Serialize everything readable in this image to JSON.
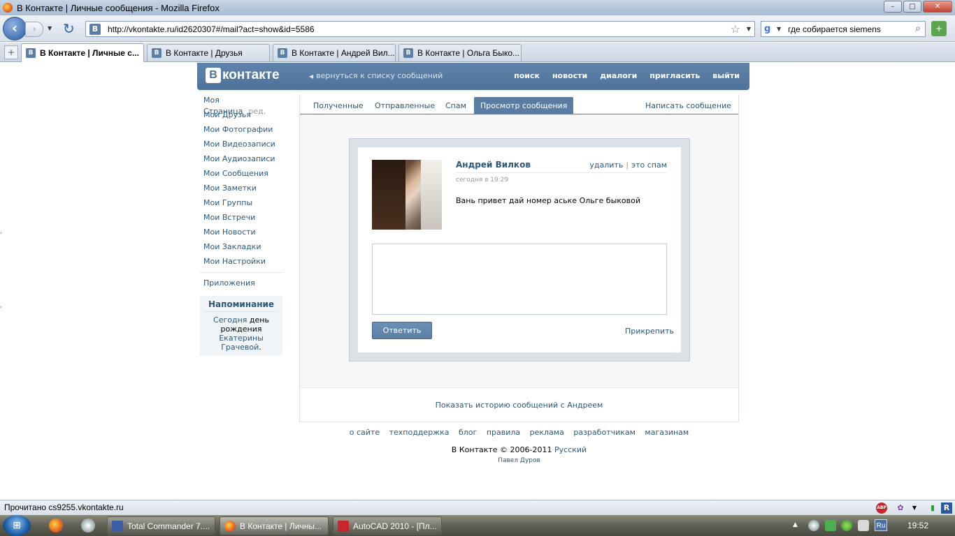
{
  "window": {
    "title": "В Контакте | Личные сообщения - Mozilla Firefox",
    "buttons": {
      "minimize": "–",
      "maximize": "□",
      "close": "✕"
    }
  },
  "navbar": {
    "url": "http://vkontakte.ru/id2620307#/mail?act=show&id=5586",
    "search_value": "где собирается siemens"
  },
  "tabs": [
    {
      "label": "В Контакте | Личные с...",
      "active": true
    },
    {
      "label": "В Контакте | Друзья",
      "active": false
    },
    {
      "label": "В Контакте | Андрей Вил...",
      "active": false
    },
    {
      "label": "В Контакте | Ольга Быко...",
      "active": false
    }
  ],
  "vk": {
    "logo_letter": "В",
    "logo_word": "контакте",
    "back_link": "вернуться к списку сообщений",
    "menu": [
      "поиск",
      "новости",
      "диалоги",
      "пригласить",
      "выйти"
    ],
    "leftnav": {
      "my_page": "Моя Страница",
      "edit": "ред.",
      "items": [
        "Мои Друзья",
        "Мои Фотографии",
        "Мои Видеозаписи",
        "Мои Аудиозаписи",
        "Мои Сообщения",
        "Мои Заметки",
        "Мои Группы",
        "Мои Встречи",
        "Мои Новости",
        "Мои Закладки",
        "Мои Настройки"
      ],
      "apps": "Приложения"
    },
    "reminder": {
      "title": "Напоминание",
      "today": "Сегодня",
      "birthday": "день рождения",
      "person": "Екатерины Грачевой",
      "period": "."
    },
    "mail_tabs": [
      "Полученные",
      "Отправленные",
      "Спам",
      "Просмотр сообщения"
    ],
    "write_link": "Написать сообщение",
    "message": {
      "sender": "Андрей Вилков",
      "delete": "удалить",
      "spam": "это спам",
      "separator": "|",
      "time": "сегодня в 19:29",
      "text": "Вань привет дай номер аське Ольге быковой"
    },
    "reply_button": "Ответить",
    "attach_link": "Прикрепить",
    "history_link": "Показать историю сообщений с Андреем",
    "footer_links": [
      "о сайте",
      "техподдержка",
      "блог",
      "правила",
      "реклама",
      "разработчикам",
      "магазинам"
    ],
    "copyright": "В Контакте © 2006-2011",
    "language": "Русский",
    "author": "Павел Дуров"
  },
  "statusbar": {
    "text": "Прочитано cs9255.vkontakte.ru"
  },
  "taskbar": {
    "items": [
      {
        "label": "Total Commander 7....",
        "active": false
      },
      {
        "label": "В Контакте | Личны...",
        "active": true
      },
      {
        "label": "AutoCAD 2010 - [Пл...",
        "active": false
      }
    ],
    "language": "Ru",
    "clock": "19:52"
  },
  "colors": {
    "vk_header": "#5f83ab",
    "vk_link": "#2b587a",
    "vk_button": "#5b7fa6"
  }
}
